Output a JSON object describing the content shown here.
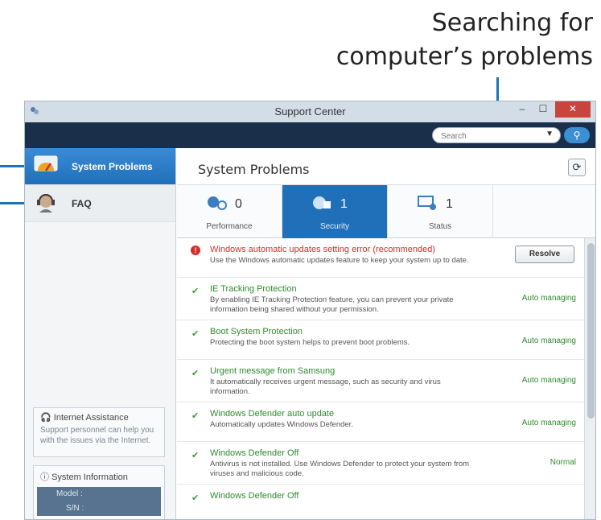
{
  "callout": {
    "line1": "Searching for",
    "line2": "computer’s problems"
  },
  "window": {
    "title": "Support Center",
    "buttons": {
      "minimize": "–",
      "maximize": "☐",
      "close": "✕"
    }
  },
  "search": {
    "placeholder": "Search"
  },
  "sidebar": {
    "items": [
      {
        "label": "System Problems",
        "icon": "system-problems-icon",
        "active": true
      },
      {
        "label": "FAQ",
        "icon": "faq-headset-icon",
        "active": false
      }
    ],
    "internet_assistance": {
      "title": "Internet Assistance",
      "text": "Support personnel can help you with the issues via the Internet."
    },
    "system_information": {
      "title": "System Information",
      "model_label": "Model :",
      "sn_label": "S/N :"
    }
  },
  "main": {
    "title": "System Problems",
    "tabs": [
      {
        "label": "Performance",
        "count": "0",
        "active": false
      },
      {
        "label": "Security",
        "count": "1",
        "active": true
      },
      {
        "label": "Status",
        "count": "1",
        "active": false
      }
    ],
    "issues": [
      {
        "title": "Windows automatic updates setting error (recommended)",
        "desc": "Use the Windows automatic updates feature to keep your system up to date.",
        "status": "",
        "action": "Resolve",
        "severity": "error"
      },
      {
        "title": "IE Tracking Protection",
        "desc": "By enabling IE Tracking Protection feature, you can prevent your private information being shared without your permission.",
        "status": "Auto managing",
        "severity": "ok"
      },
      {
        "title": "Boot System Protection",
        "desc": "Protecting the boot system helps to prevent boot problems.",
        "status": "Auto managing",
        "severity": "ok"
      },
      {
        "title": "Urgent message from Samsung",
        "desc": "It automatically receives urgent message, such as security and virus information.",
        "status": "Auto managing",
        "severity": "ok"
      },
      {
        "title": "Windows Defender auto update",
        "desc": "Automatically updates Windows Defender.",
        "status": "Auto managing",
        "severity": "ok"
      },
      {
        "title": "Windows Defender Off",
        "desc": "Antivirus is not installed. Use Windows Defender to protect your system from viruses and malicious code.",
        "status": "Normal",
        "severity": "ok"
      },
      {
        "title": "Windows Defender Off",
        "desc": "",
        "status": "",
        "severity": "ok"
      }
    ]
  },
  "colors": {
    "accent": "#1f6fb9",
    "toolbar": "#192f4a",
    "error": "#d82c2c",
    "ok": "#2e8b2e"
  }
}
